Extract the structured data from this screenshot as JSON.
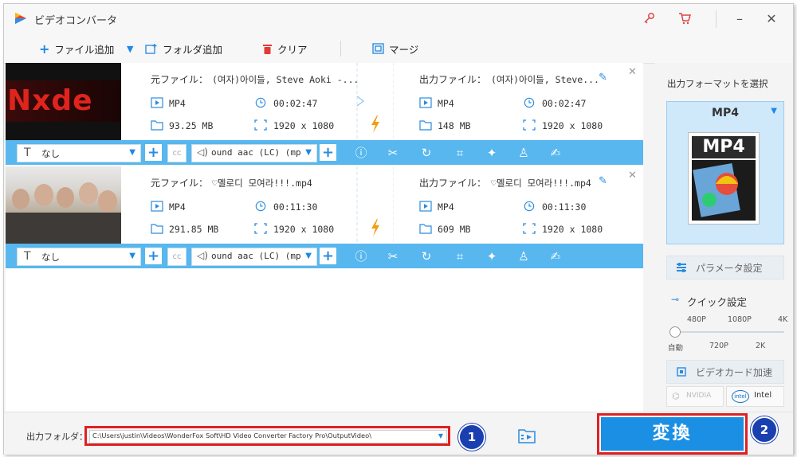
{
  "title_bar": {
    "app_title": "ビデオコンバータ",
    "logo_colors": [
      "#e8452c",
      "#2f8ee8",
      "#f7b619"
    ]
  },
  "toolbar": {
    "add_file": "ファイル追加",
    "add_folder": "フォルダ追加",
    "clear": "クリア",
    "merge": "マージ"
  },
  "files": [
    {
      "thumb_text": "Nxde",
      "source_label": "元ファイル：",
      "source_name": "(여자)아이들, Steve Aoki -...",
      "src_format": "MP4",
      "src_duration": "00:02:47",
      "src_size": "93.25 MB",
      "src_resolution": "1920 x 1080",
      "output_label": "出力ファイル：",
      "output_name": "(여자)아이들, Steve...",
      "out_format": "MP4",
      "out_duration": "00:02:47",
      "out_size": "148 MB",
      "out_resolution": "1920 x 1080",
      "subtitle": "なし",
      "audio": "ound aac (LC) (mp"
    },
    {
      "thumb_text": "",
      "source_label": "元ファイル：",
      "source_name": "♡멜로디 모여라!!!.mp4",
      "src_format": "MP4",
      "src_duration": "00:11:30",
      "src_size": "291.85 MB",
      "src_resolution": "1920 x 1080",
      "output_label": "出力ファイル：",
      "output_name": "♡멜로디 모여라!!!.mp4",
      "out_format": "MP4",
      "out_duration": "00:11:30",
      "out_size": "609 MB",
      "out_resolution": "1920 x 1080",
      "subtitle": "なし",
      "audio": "ound aac (LC) (mp"
    }
  ],
  "side": {
    "output_format_title": "出力フォーマットを選択",
    "format_name": "MP4",
    "format_icon_text": "MP4",
    "parameter_settings": "パラメータ設定",
    "quick_settings": "クイック設定",
    "quality_top": [
      "480P",
      "1080P",
      "4K"
    ],
    "quality_bottom": [
      "自動",
      "720P",
      "2K"
    ],
    "gpu_accel": "ビデオカード加速",
    "nvidia": "NVIDIA",
    "intel_logo": "intel",
    "intel": "Intel"
  },
  "bottom": {
    "output_folder_label": "出力フォルダ：",
    "output_path": "C:\\Users\\justin\\Videos\\WonderFox Soft\\HD Video Converter Factory Pro\\OutputVideo\\",
    "convert": "変換",
    "badge1": "1",
    "badge2": "2"
  },
  "colors": {
    "accent": "#57b7ee",
    "convert_bg": "#1a8fe3",
    "highlight_red": "#e02020",
    "badge": "#1a3fb0",
    "lightning": "#f39c12"
  }
}
